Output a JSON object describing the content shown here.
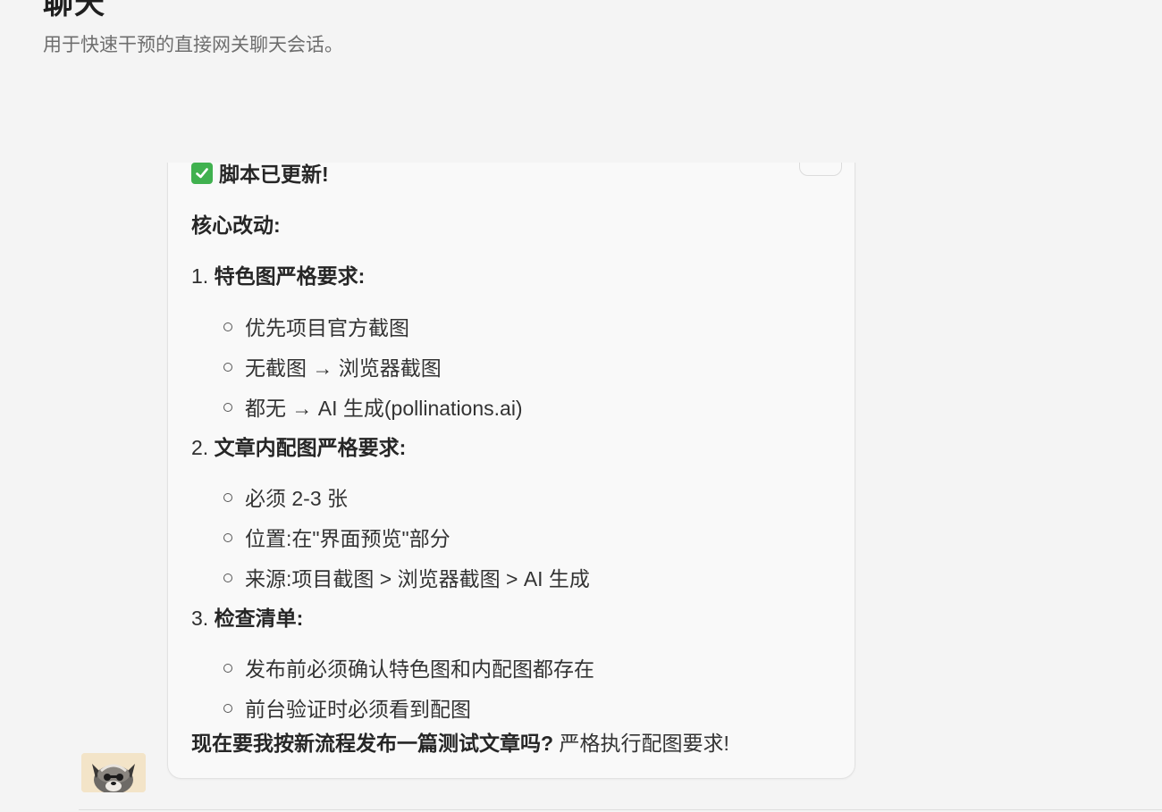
{
  "page": {
    "title": "聊天",
    "subtitle": "用于快速干预的直接网关聊天会话。"
  },
  "message": {
    "heading": "脚本已更新!",
    "section_label": "核心改动:",
    "items": [
      {
        "number": "1.",
        "title": "特色图严格要求:",
        "bullets": [
          "优先项目官方截图",
          "无截图 → 浏览器截图",
          "都无 → AI 生成(pollinations.ai)"
        ]
      },
      {
        "number": "2.",
        "title": "文章内配图严格要求:",
        "bullets": [
          "必须 2-3 张",
          "位置:在\"界面预览\"部分",
          "来源:项目截图 > 浏览器截图 > AI 生成"
        ]
      },
      {
        "number": "3.",
        "title": "检查清单:",
        "bullets": [
          "发布前必须确认特色图和内配图都存在",
          "前台验证时必须看到配图"
        ]
      }
    ],
    "closing_bold": "现在要我按新流程发布一篇测试文章吗?",
    "closing_text": "严格执行配图要求!"
  },
  "icons": {
    "heading_icon": "check-mark-icon",
    "copy_icon": "copy-icon",
    "avatar": "dog-avatar"
  },
  "colors": {
    "check_green": "#40b14f",
    "background": "#f4f4f4",
    "bubble": "#f9f9f9"
  }
}
